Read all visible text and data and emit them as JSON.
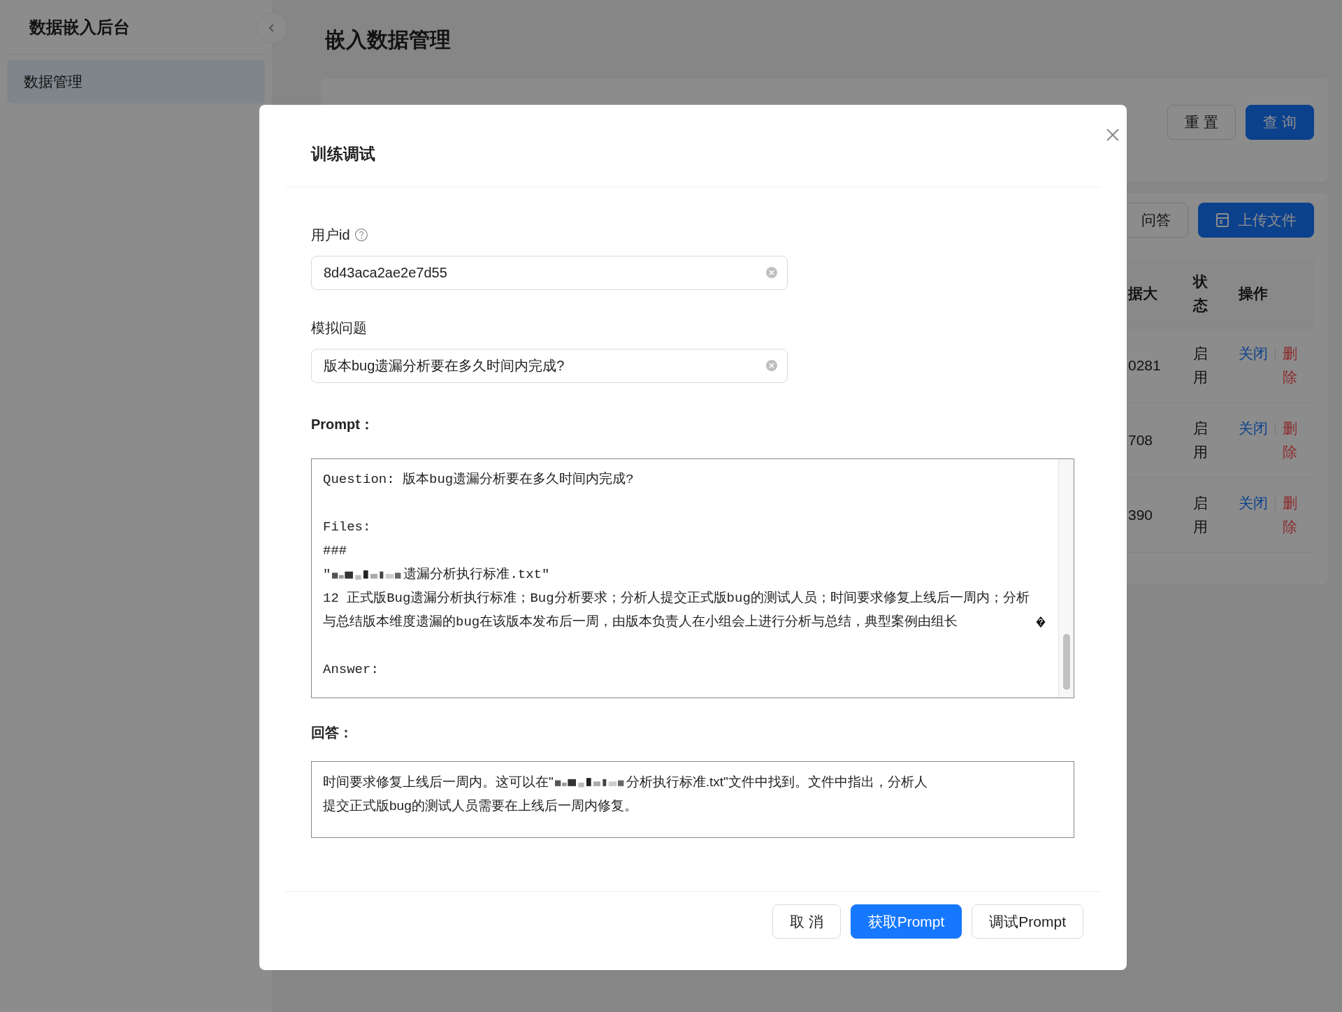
{
  "sidebar": {
    "title": "数据嵌入后台",
    "items": [
      {
        "label": "数据管理",
        "selected": true
      }
    ]
  },
  "page": {
    "title": "嵌入数据管理"
  },
  "filter": {
    "buttons": [
      {
        "label": "重 置",
        "kind": "default"
      },
      {
        "label": "查 询",
        "kind": "primary"
      }
    ]
  },
  "toolbar": {
    "buttons": [
      {
        "label": "问答",
        "kind": "default",
        "icon": false
      },
      {
        "label": "上传文件",
        "kind": "primary",
        "icon": true
      }
    ]
  },
  "table": {
    "columns": [
      "据大",
      "状态",
      "操作"
    ],
    "rows": [
      {
        "size": "0281",
        "status": "启用",
        "actions": [
          {
            "label": "关闭",
            "kind": "link"
          },
          {
            "label": "删除",
            "kind": "danger"
          }
        ]
      },
      {
        "size": "708",
        "status": "启用",
        "actions": [
          {
            "label": "关闭",
            "kind": "link"
          },
          {
            "label": "删除",
            "kind": "danger"
          }
        ]
      },
      {
        "size": "390",
        "status": "启用",
        "actions": [
          {
            "label": "关闭",
            "kind": "link"
          },
          {
            "label": "删除",
            "kind": "danger"
          }
        ]
      }
    ]
  },
  "modal": {
    "title": "训练调试",
    "fields": [
      {
        "label": "用户id",
        "help": true,
        "value": "8d43aca2ae2e7d55"
      },
      {
        "label": "模拟问题",
        "value": "版本bug遗漏分析要在多久时间内完成?"
      }
    ],
    "prompt": {
      "label": "Prompt：",
      "lines": [
        {
          "kind": "text",
          "text": "Question: 版本bug遗漏分析要在多久时间内完成?"
        },
        {
          "kind": "blank"
        },
        {
          "kind": "text",
          "text": "Files:"
        },
        {
          "kind": "text",
          "text": "###"
        },
        {
          "kind": "file",
          "before": "\"",
          "after": "遗漏分析执行标准.txt\""
        },
        {
          "kind": "text",
          "text": "12 正式版Bug遗漏分析执行标准；Bug分析要求；分析人提交正式版bug的测试人员；时间要求修复上线后一周内；分析与总结版本维度遗漏的bug在该版本发布后一周，由版本负责人在小组会上进行分析与总结，典型案例由组长",
          "broken_char": true
        },
        {
          "kind": "blank"
        },
        {
          "kind": "text",
          "text": "Answer:"
        }
      ]
    },
    "answer": {
      "label": "回答：",
      "lines": [
        {
          "kind": "file",
          "before": "时间要求修复上线后一周内。这可以在\"",
          "after": "分析执行标准.txt\"文件中找到。文件中指出，分析人"
        },
        {
          "kind": "text",
          "text": "提交正式版bug的测试人员需要在上线后一周内修复。"
        }
      ]
    },
    "buttons": [
      {
        "label": "取 消",
        "kind": "default"
      },
      {
        "label": "获取Prompt",
        "kind": "primary"
      },
      {
        "label": "调试Prompt",
        "kind": "default"
      }
    ]
  }
}
